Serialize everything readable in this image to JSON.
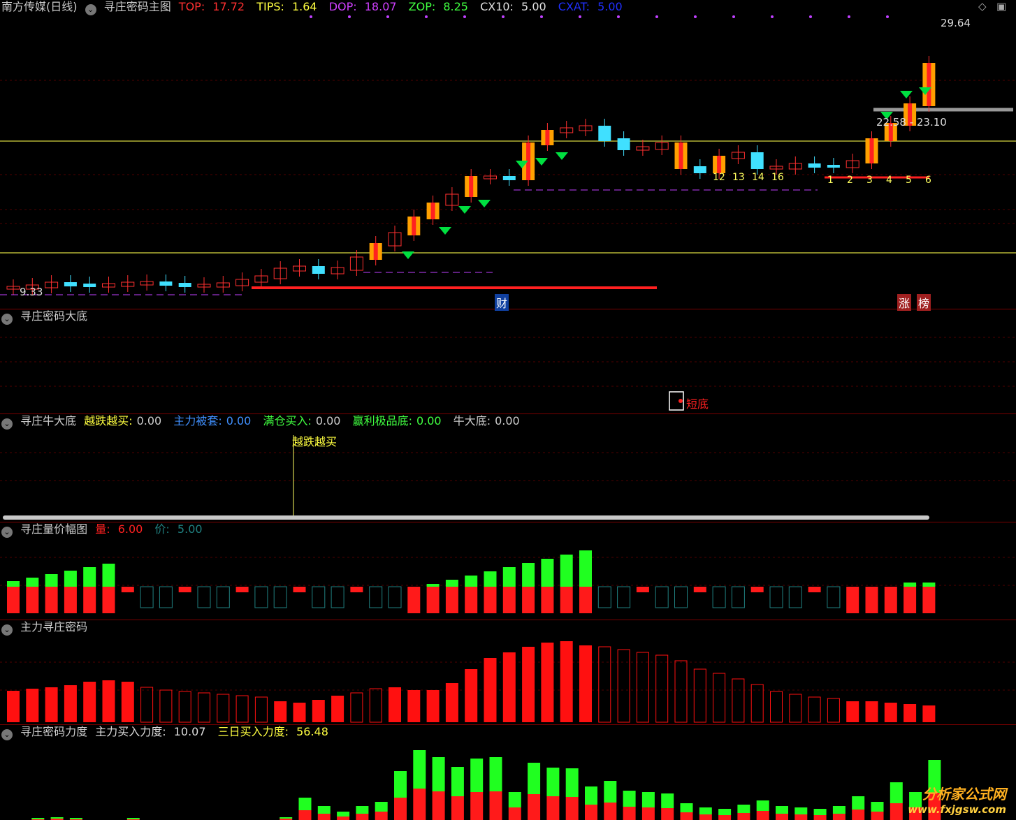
{
  "main": {
    "stock": "南方传媒(日线)",
    "indicator": "寻庄密码主图",
    "top": {
      "label": "TOP:",
      "value": "17.72"
    },
    "tips": {
      "label": "TIPS:",
      "value": "1.64"
    },
    "dop": {
      "label": "DOP:",
      "value": "18.07"
    },
    "zop": {
      "label": "ZOP:",
      "value": "8.25"
    },
    "cx10": {
      "label": "CX10:",
      "value": "5.00"
    },
    "cxat": {
      "label": "CXAT:",
      "value": "5.00"
    },
    "high_label": "29.64",
    "low_label": "9.33",
    "range_label": "22.58 - 23.10",
    "tag_cai": "财",
    "tag_zhang": "涨",
    "tag_bang": "榜",
    "counts_a": [
      "12",
      "13",
      "14",
      "16"
    ],
    "counts_b": [
      "1",
      "2",
      "3",
      "4",
      "5",
      "6"
    ]
  },
  "panel2": {
    "title": "寻庄密码大底",
    "signal": "短底"
  },
  "panel3": {
    "title": "寻庄牛大底",
    "items": [
      {
        "label": "越跌越买:",
        "value": "0.00"
      },
      {
        "label": "主力被套:",
        "value": "0.00"
      },
      {
        "label": "满仓买入:",
        "value": "0.00"
      },
      {
        "label": "赢利极品底:",
        "value": "0.00"
      },
      {
        "label": "牛大底:",
        "value": "0.00"
      }
    ],
    "marker": "越跌越买"
  },
  "panel4": {
    "title": "寻庄量价幅图",
    "vol_label": "量:",
    "vol_value": "6.00",
    "price_label": "价:",
    "price_value": "5.00"
  },
  "panel5": {
    "title": "主力寻庄密码"
  },
  "panel6": {
    "title": "寻庄密码力度",
    "main_label": "主力买入力度:",
    "main_value": "10.07",
    "three_label": "三日买入力度:",
    "three_value": "56.48"
  },
  "watermark": {
    "cn": "分析家公式网",
    "url": "www.fxjgsw.com"
  },
  "colors": {
    "up": "#ff2020",
    "down": "#40e0ff",
    "ma": "#ffff60",
    "purple": "#c040ff",
    "green": "#00ff00"
  }
}
